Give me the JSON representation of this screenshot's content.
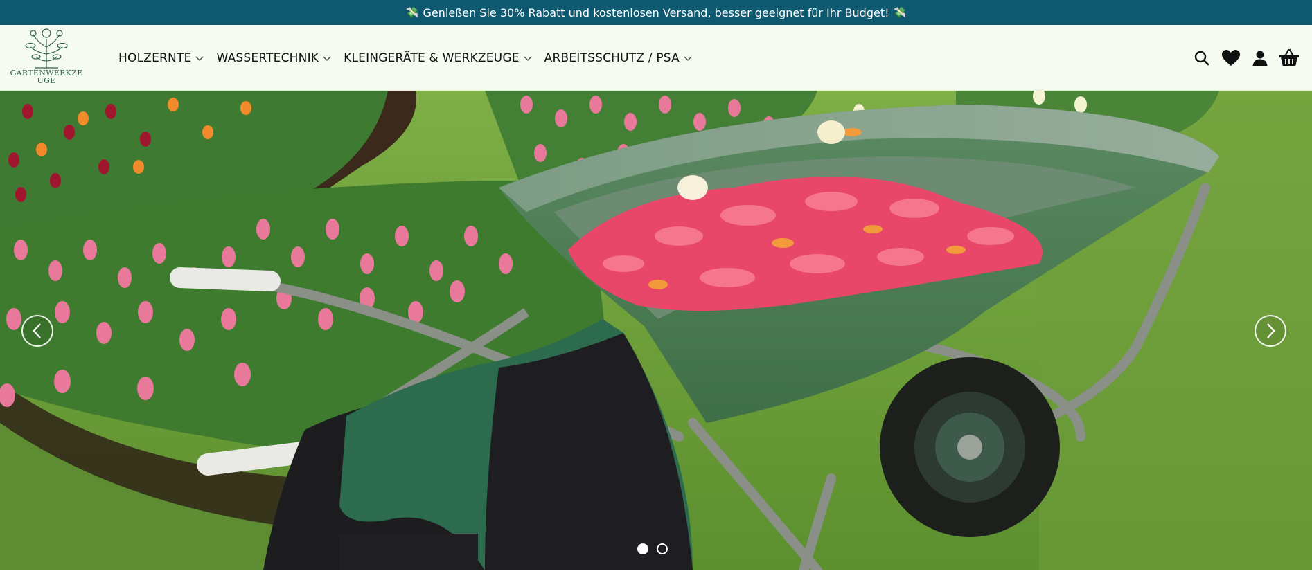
{
  "announcement": {
    "text": "Genießen Sie 30% Rabatt und kostenlosen Versand, besser geeignet für Ihr Budget!",
    "emoji": "💸"
  },
  "logo": {
    "line1": "GARTENWERKZE",
    "line2": "UGE"
  },
  "nav": {
    "items": [
      {
        "label": "HOLZERNTE"
      },
      {
        "label": "WASSERTECHNIK"
      },
      {
        "label": "KLEINGERÄTE & WERKZEUGE"
      },
      {
        "label": "ARBEITSSCHUTZ / PSA"
      }
    ]
  },
  "header_icons": [
    "search-icon",
    "heart-icon",
    "account-icon",
    "cart-icon"
  ],
  "hero": {
    "slides_total": 2,
    "active_slide": 1
  },
  "colors": {
    "announcement_bg": "#0e5870",
    "header_bg": "#f6fbf1",
    "logo_green": "#2f5e4b"
  }
}
